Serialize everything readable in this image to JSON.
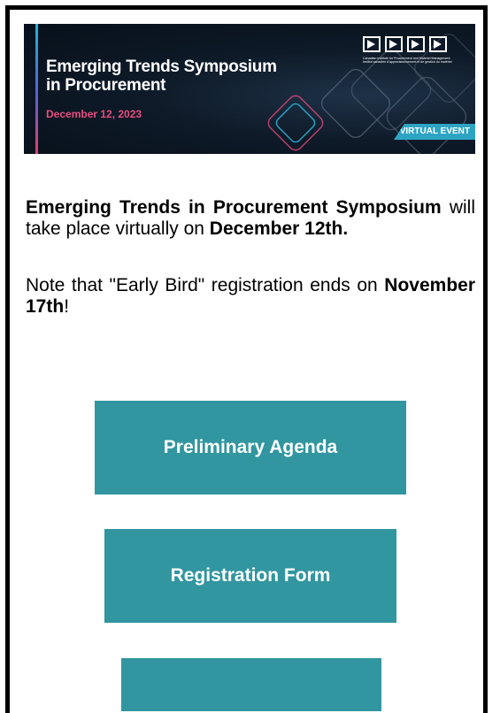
{
  "banner": {
    "title_line1": "Emerging Trends Symposium",
    "title_line2": "in Procurement",
    "date": "December 12, 2023",
    "org_line1": "Canadian Institute for Procurement and Materiel Management",
    "org_line2": "Institut canadien d'approvisionnement et de gestion du matériel",
    "badge": "VIRTUAL EVENT",
    "colors": {
      "accent_pink": "#e84d7e",
      "accent_cyan": "#2ea4c4",
      "background": "#0e1a28"
    }
  },
  "intro": {
    "event_name": "Emerging Trends in Procurement Symposium",
    "middle": " will take place virtually on ",
    "date": "December 12th."
  },
  "note": {
    "before": "Note that \"Early Bird\" registration ends on ",
    "date": "November 17th",
    "after": "!"
  },
  "buttons": {
    "agenda": "Preliminary Agenda",
    "registration": "Registration Form",
    "third": ""
  },
  "colors": {
    "button": "#31969f",
    "border": "#000000"
  }
}
